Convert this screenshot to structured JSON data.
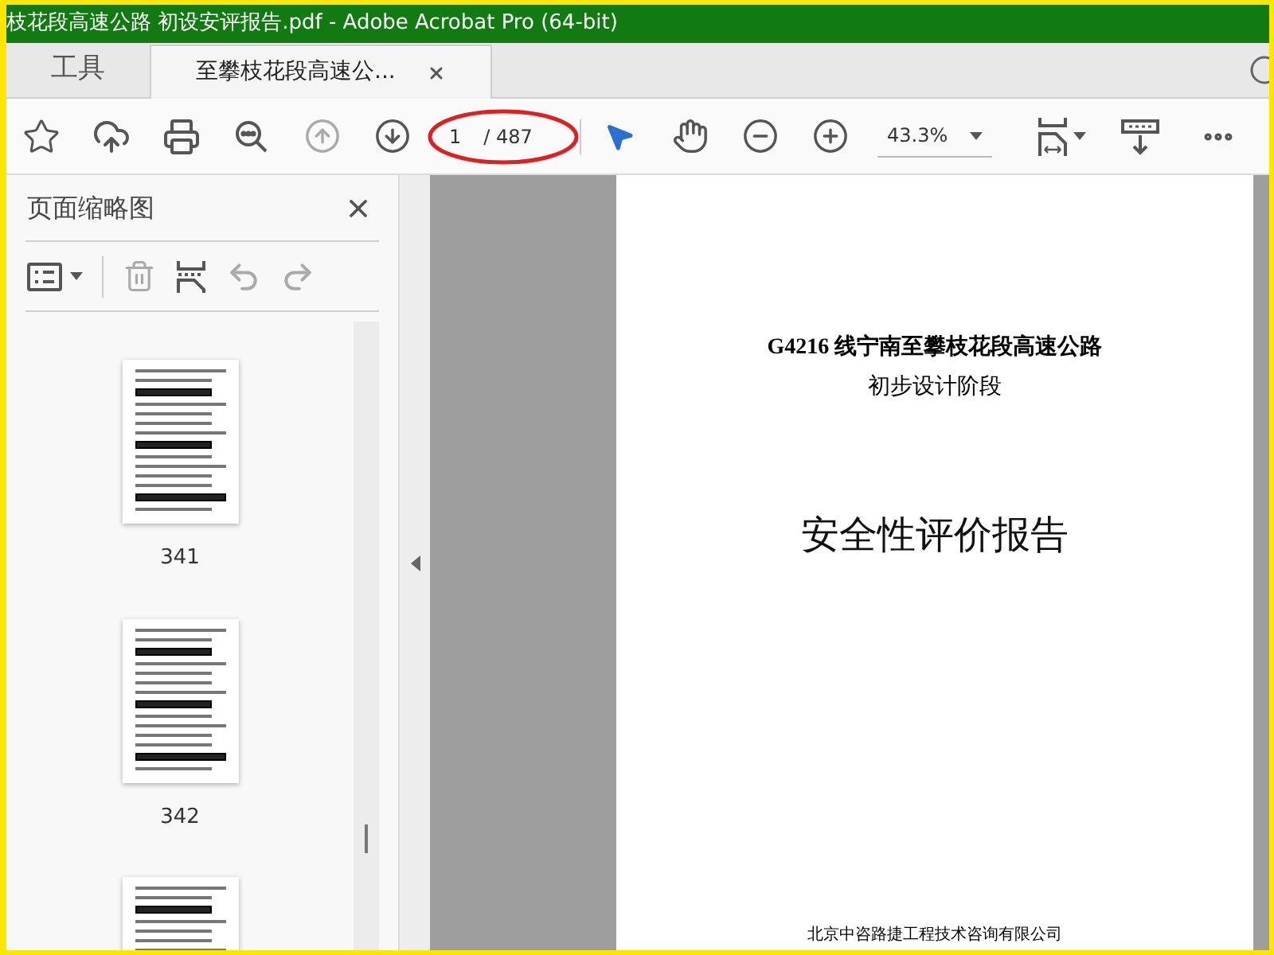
{
  "window": {
    "title": "枝花段高速公路 初设安评报告.pdf - Adobe Acrobat Pro (64-bit)"
  },
  "tabs": [
    {
      "label": "工具",
      "selected": false,
      "closable": false
    },
    {
      "label": "至攀枝花段高速公...",
      "selected": true,
      "closable": true
    }
  ],
  "toolbar": {
    "page_value": "1",
    "page_total": "/ 487",
    "page_highlighted": true,
    "zoom": "43.3%"
  },
  "sidebar": {
    "title": "页面缩略图",
    "thumbnails": [
      {
        "kind": "labeled",
        "label": "341"
      },
      {
        "kind": "labeled",
        "label": "342"
      },
      {
        "kind": "cut"
      }
    ]
  },
  "document": {
    "heading_lines": [
      "G4216 线宁南至攀枝花段高速公路",
      "初步设计阶段"
    ],
    "title": "安全性评价报告",
    "footer": "北京中咨路捷工程技术咨询有限公司"
  }
}
